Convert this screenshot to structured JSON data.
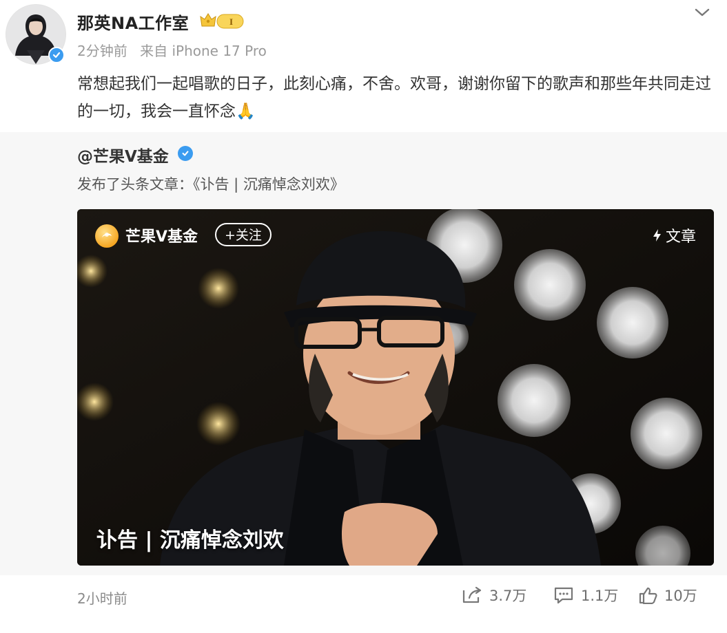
{
  "post": {
    "author": "那英NA工作室",
    "rank_badge": "I",
    "meta": {
      "time": "2分钟前",
      "source": "来自 iPhone 17 Pro"
    },
    "text": "常想起我们一起唱歌的日子，此刻心痛，不舍。欢哥，谢谢你留下的歌声和那些年共同走过的一切，我会一直怀念🙏"
  },
  "repost": {
    "author": "@芒果V基金",
    "desc": "发布了头条文章：《讣告 | 沉痛悼念刘欢》",
    "card": {
      "source_name": "芒果V基金",
      "follow_label": "+关注",
      "type_label": "文章",
      "headline": "讣告 | 沉痛悼念刘欢"
    }
  },
  "footer": {
    "time": "2小时前",
    "share_count": "3.7万",
    "comment_count": "1.1万",
    "like_count": "10万"
  },
  "icons": {
    "verified": "verified-check-icon",
    "chevron": "chevron-down-icon",
    "share": "share-icon",
    "comment": "comment-icon",
    "like": "thumbs-up-icon",
    "bolt": "lightning-icon"
  },
  "colors": {
    "verified_blue": "#3b9cf0",
    "badge_gold": "#f5c53a",
    "repost_bg": "#f7f7f7"
  }
}
